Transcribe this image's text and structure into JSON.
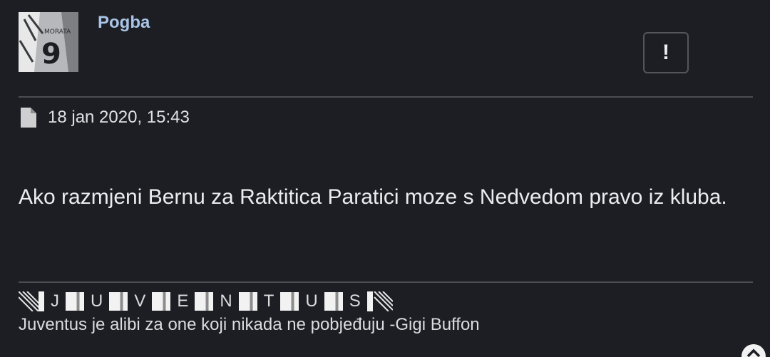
{
  "post": {
    "username": "Pogba",
    "report_label": "!",
    "timestamp": "18 jan 2020, 15:43",
    "message": "Ako razmjeni Bernu za Raktitica Paratici moze s Nedvedom pravo iz kluba.",
    "avatar": {
      "jersey_name": "MORATA",
      "jersey_number": "9"
    }
  },
  "signature": {
    "letters": [
      "J",
      "U",
      "V",
      "E",
      "N",
      "T",
      "U",
      "S"
    ],
    "quote": "Juventus je alibi za one koji nikada ne pobjeđuju -Gigi Buffon"
  },
  "icons": {
    "report": "exclamation-icon",
    "timestamp": "file-icon",
    "scroll": "chevron-up-icon"
  },
  "colors": {
    "background": "#1d1e24",
    "username": "#a9c5e6",
    "text": "#ececee",
    "divider": "#4c4d52"
  }
}
